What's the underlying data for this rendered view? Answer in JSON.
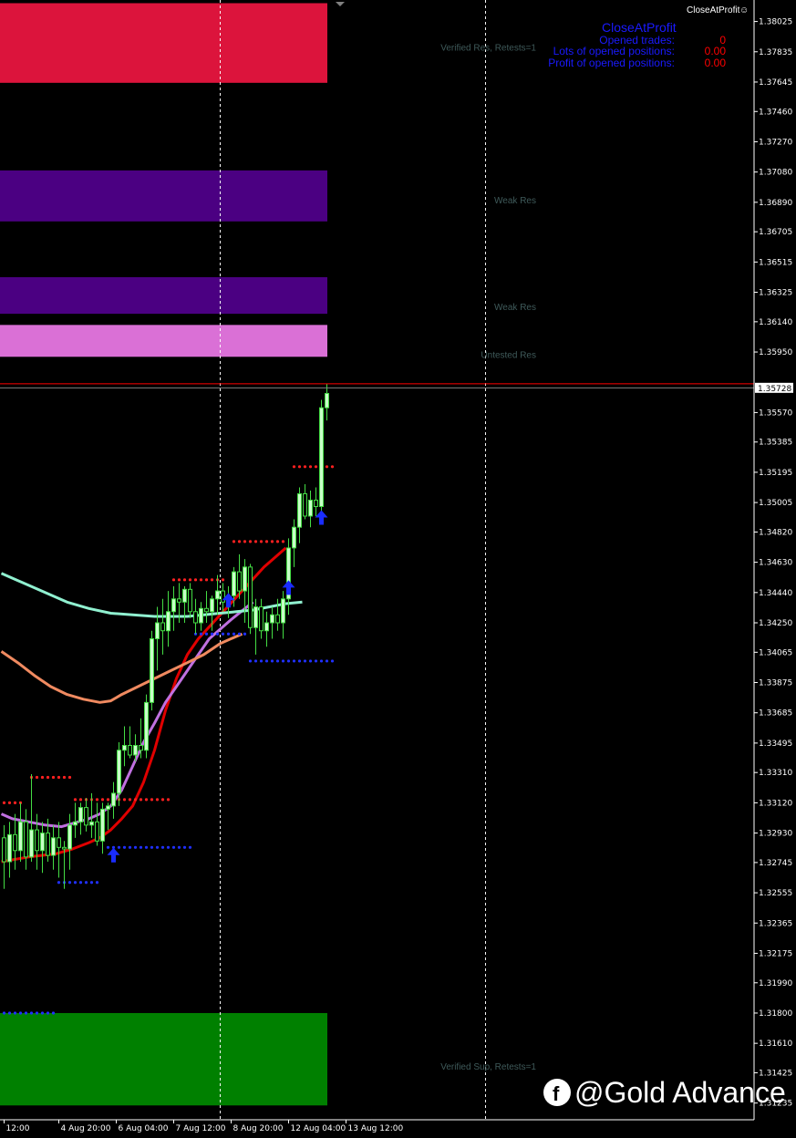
{
  "ea_name": "CloseAtProfit",
  "ea_smiley": "☺",
  "cap_panel": {
    "title": "CloseAtProfit",
    "rows": [
      {
        "label": "Opened trades:",
        "value": "0"
      },
      {
        "label": "Lots of opened positions:",
        "value": "0.00"
      },
      {
        "label": "Profit of opened positions:",
        "value": "0.00"
      }
    ]
  },
  "watermark": "@Gold Advance",
  "colors": {
    "background": "#000000",
    "bull_candle": "#c8ffc8",
    "wick": "#44dd44",
    "ma_red": "#e00000",
    "ma_violet": "#c070e0",
    "ma_salmon": "#f08a60",
    "ma_aqua": "#90f0d0",
    "resistance_dots": "#ff2020",
    "support_dots": "#2030ff",
    "zone_crimson": "#dc143c",
    "zone_indigo": "#4b0082",
    "zone_orchid": "#da70d6",
    "zone_green": "#008000"
  },
  "chart_data": {
    "type": "candlestick",
    "y_range": [
      1.3113,
      1.3816
    ],
    "x_range_bars": [
      0,
      60
    ],
    "y_ticks": [
      "1.38025",
      "1.37835",
      "1.37645",
      "1.37460",
      "1.37270",
      "1.37080",
      "1.36890",
      "1.36705",
      "1.36515",
      "1.36325",
      "1.36140",
      "1.35950",
      "1.35728",
      "1.35570",
      "1.35385",
      "1.35195",
      "1.35005",
      "1.34820",
      "1.34630",
      "1.34440",
      "1.34250",
      "1.34065",
      "1.33875",
      "1.33685",
      "1.33495",
      "1.33310",
      "1.33120",
      "1.32930",
      "1.32745",
      "1.32555",
      "1.32365",
      "1.32175",
      "1.31990",
      "1.31800",
      "1.31610",
      "1.31425",
      "1.31235"
    ],
    "current_price": "1.35728",
    "x_ticks": [
      {
        "bar": 0.5,
        "label": "12:00"
      },
      {
        "bar": 10.5,
        "label": "4 Aug 20:00"
      },
      {
        "bar": 21.0,
        "label": "6 Aug 04:00"
      },
      {
        "bar": 31.5,
        "label": "7 Aug 12:00"
      },
      {
        "bar": 42.0,
        "label": "8 Aug 20:00"
      },
      {
        "bar": 52.5,
        "label": "12 Aug 04:00"
      },
      {
        "bar": 63.0,
        "label": "13 Aug 12:00"
      }
    ],
    "vertical_period_lines_bar": [
      40.0,
      88.5
    ],
    "zones": [
      {
        "top": 1.3814,
        "bottom": 1.3764,
        "color": "crimson",
        "label": "Verified Res, Retests=1"
      },
      {
        "top": 1.3709,
        "bottom": 1.3677,
        "color": "indigo",
        "label": "Weak Res"
      },
      {
        "top": 1.3642,
        "bottom": 1.3619,
        "color": "indigo",
        "label": "Weak Res"
      },
      {
        "top": 1.3612,
        "bottom": 1.3592,
        "color": "orchid",
        "label": "Untested Res"
      },
      {
        "top": 1.318,
        "bottom": 1.3122,
        "color": "green",
        "label": "Verified Sup, Retests=1"
      }
    ],
    "candles": [
      [
        1.329,
        1.3298,
        1.3258,
        1.3275
      ],
      [
        1.3275,
        1.33,
        1.3265,
        1.3292
      ],
      [
        1.3292,
        1.3305,
        1.327,
        1.3282
      ],
      [
        1.3282,
        1.3312,
        1.3275,
        1.33
      ],
      [
        1.33,
        1.3308,
        1.327,
        1.3278
      ],
      [
        1.3278,
        1.333,
        1.3275,
        1.3295
      ],
      [
        1.3295,
        1.3305,
        1.327,
        1.3282
      ],
      [
        1.3282,
        1.33,
        1.3268,
        1.3293
      ],
      [
        1.3293,
        1.3302,
        1.3275,
        1.3279
      ],
      [
        1.3279,
        1.3298,
        1.327,
        1.329
      ],
      [
        1.329,
        1.33,
        1.3265,
        1.3284
      ],
      [
        1.3284,
        1.3288,
        1.3258,
        1.3283
      ],
      [
        1.3283,
        1.3305,
        1.327,
        1.3298
      ],
      [
        1.3298,
        1.3312,
        1.329,
        1.33
      ],
      [
        1.33,
        1.3312,
        1.3292,
        1.3309
      ],
      [
        1.3309,
        1.3315,
        1.3294,
        1.3298
      ],
      [
        1.3298,
        1.3318,
        1.329,
        1.33
      ],
      [
        1.33,
        1.3312,
        1.3285,
        1.3288
      ],
      [
        1.3288,
        1.3312,
        1.328,
        1.3308
      ],
      [
        1.3308,
        1.3312,
        1.3295,
        1.331
      ],
      [
        1.331,
        1.3325,
        1.3302,
        1.3318
      ],
      [
        1.3318,
        1.335,
        1.331,
        1.3345
      ],
      [
        1.3345,
        1.336,
        1.3335,
        1.3348
      ],
      [
        1.3348,
        1.336,
        1.334,
        1.3342
      ],
      [
        1.3342,
        1.3355,
        1.3338,
        1.3348
      ],
      [
        1.3348,
        1.3365,
        1.334,
        1.3345
      ],
      [
        1.3345,
        1.338,
        1.334,
        1.3375
      ],
      [
        1.3375,
        1.342,
        1.337,
        1.3415
      ],
      [
        1.3415,
        1.3435,
        1.3395,
        1.3425
      ],
      [
        1.3425,
        1.344,
        1.3405,
        1.342
      ],
      [
        1.342,
        1.3445,
        1.341,
        1.3432
      ],
      [
        1.3432,
        1.3448,
        1.342,
        1.344
      ],
      [
        1.344,
        1.345,
        1.3425,
        1.3438
      ],
      [
        1.3438,
        1.3448,
        1.3425,
        1.3446
      ],
      [
        1.3446,
        1.345,
        1.3428,
        1.3432
      ],
      [
        1.3432,
        1.344,
        1.3418,
        1.3425
      ],
      [
        1.3425,
        1.3438,
        1.342,
        1.3434
      ],
      [
        1.3434,
        1.3445,
        1.3425,
        1.3432
      ],
      [
        1.3432,
        1.3442,
        1.342,
        1.344
      ],
      [
        1.344,
        1.3455,
        1.343,
        1.3445
      ],
      [
        1.3445,
        1.345,
        1.3432,
        1.3438
      ],
      [
        1.3438,
        1.3448,
        1.3428,
        1.3442
      ],
      [
        1.3442,
        1.346,
        1.3435,
        1.3457
      ],
      [
        1.3457,
        1.3468,
        1.344,
        1.3445
      ],
      [
        1.3445,
        1.3465,
        1.3425,
        1.346
      ],
      [
        1.346,
        1.3462,
        1.3418,
        1.3422
      ],
      [
        1.3422,
        1.344,
        1.3405,
        1.3435
      ],
      [
        1.3435,
        1.344,
        1.3415,
        1.342
      ],
      [
        1.342,
        1.3432,
        1.341,
        1.3425
      ],
      [
        1.3425,
        1.3435,
        1.3415,
        1.343
      ],
      [
        1.343,
        1.344,
        1.342,
        1.3425
      ],
      [
        1.3425,
        1.3445,
        1.3415,
        1.344
      ],
      [
        1.344,
        1.3478,
        1.343,
        1.3472
      ],
      [
        1.3472,
        1.349,
        1.346,
        1.3485
      ],
      [
        1.3485,
        1.351,
        1.3475,
        1.3506
      ],
      [
        1.3506,
        1.3512,
        1.349,
        1.3492
      ],
      [
        1.3492,
        1.3508,
        1.3485,
        1.3502
      ],
      [
        1.3502,
        1.351,
        1.3492,
        1.3498
      ],
      [
        1.3498,
        1.3565,
        1.3492,
        1.356
      ],
      [
        1.356,
        1.3575,
        1.3552,
        1.3569
      ]
    ],
    "series": [
      {
        "values": [
          1.3275,
          1.3278,
          1.328,
          1.3283,
          1.3287,
          1.329,
          1.3295,
          1.3302,
          1.331,
          1.3325,
          1.3345,
          1.337,
          1.339,
          1.3405,
          1.3415,
          1.343,
          1.3445,
          1.346,
          1.3472
        ],
        "x_bars": [
          0,
          5,
          10,
          13,
          16,
          18,
          20,
          22,
          24,
          26,
          28,
          30,
          32,
          34,
          36,
          40,
          44,
          48,
          52
        ],
        "color_key": "ma_red"
      },
      {
        "values": [
          1.3305,
          1.3302,
          1.33,
          1.3298,
          1.3297,
          1.33,
          1.3302,
          1.3305,
          1.331,
          1.332,
          1.3335,
          1.335,
          1.3362,
          1.3375,
          1.3385,
          1.3395,
          1.3405,
          1.3415,
          1.3427,
          1.3438
        ],
        "x_bars": [
          0,
          2,
          5,
          8,
          11,
          14,
          16,
          18,
          20,
          22,
          24,
          26,
          28,
          30,
          32,
          34,
          36,
          38,
          42,
          46
        ],
        "color_key": "ma_violet"
      },
      {
        "values": [
          1.3407,
          1.34,
          1.3392,
          1.3385,
          1.338,
          1.3377,
          1.3375,
          1.3376,
          1.338,
          1.3385,
          1.339,
          1.3395,
          1.34,
          1.3405,
          1.3412,
          1.3418
        ],
        "x_bars": [
          0,
          3,
          6,
          9,
          12,
          15,
          18,
          20,
          22,
          25,
          28,
          31,
          34,
          37,
          40,
          44
        ],
        "color_key": "ma_salmon"
      },
      {
        "values": [
          1.3456,
          1.345,
          1.3444,
          1.3438,
          1.3434,
          1.3431,
          1.343,
          1.3429,
          1.3429,
          1.3429,
          1.343,
          1.3431,
          1.3432,
          1.3433,
          1.3435,
          1.3437,
          1.3438
        ],
        "x_bars": [
          0,
          4,
          8,
          12,
          16,
          20,
          24,
          28,
          31,
          34,
          37,
          40,
          43,
          46,
          49,
          52,
          55
        ],
        "color_key": "ma_aqua"
      }
    ],
    "resistance_dots": [
      {
        "price": 1.3312,
        "from": 0,
        "to": 3
      },
      {
        "price": 1.3328,
        "from": 5,
        "to": 12
      },
      {
        "price": 1.3314,
        "from": 13,
        "to": 30
      },
      {
        "price": 1.3452,
        "from": 31,
        "to": 40
      },
      {
        "price": 1.3476,
        "from": 42,
        "to": 51
      },
      {
        "price": 1.3523,
        "from": 53,
        "to": 60
      }
    ],
    "support_dots": [
      {
        "price": 1.3262,
        "from": 10,
        "to": 17
      },
      {
        "price": 1.3284,
        "from": 19,
        "to": 34
      },
      {
        "price": 1.3418,
        "from": 35,
        "to": 44
      },
      {
        "price": 1.3401,
        "from": 45,
        "to": 60
      },
      {
        "price": 1.318,
        "from": 0,
        "to": 9
      }
    ],
    "buy_arrows": [
      {
        "bar": 20,
        "price": 1.3278
      },
      {
        "bar": 41,
        "price": 1.3438
      },
      {
        "bar": 52,
        "price": 1.3446
      },
      {
        "bar": 58,
        "price": 1.349
      }
    ]
  }
}
